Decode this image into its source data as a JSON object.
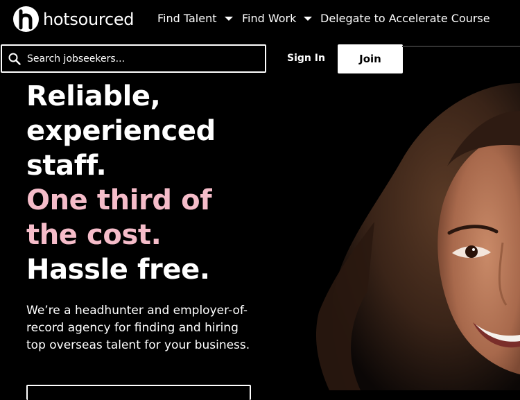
{
  "brand": {
    "name": "hotsourced"
  },
  "nav": {
    "find_talent": "Find Talent",
    "find_work": "Find Work",
    "delegate": "Delegate to Accelerate Course"
  },
  "search": {
    "placeholder": "Search jobseekers..."
  },
  "auth": {
    "sign_in": "Sign In",
    "join": "Join"
  },
  "hero": {
    "line1": "Reliable,",
    "line2": "experienced",
    "line3": "staff.",
    "line4": "One third of",
    "line5": "the cost.",
    "line6": "Hassle free.",
    "description": "We’re a headhunter and employer-of-record agency for finding and hiring top overseas talent for your business."
  },
  "colors": {
    "background": "#000000",
    "accent_pink": "#f5bcc9",
    "text": "#ffffff"
  },
  "icons": {
    "logo": "hotsourced-logo-icon",
    "search": "search-icon",
    "dropdown": "chevron-down-icon"
  }
}
